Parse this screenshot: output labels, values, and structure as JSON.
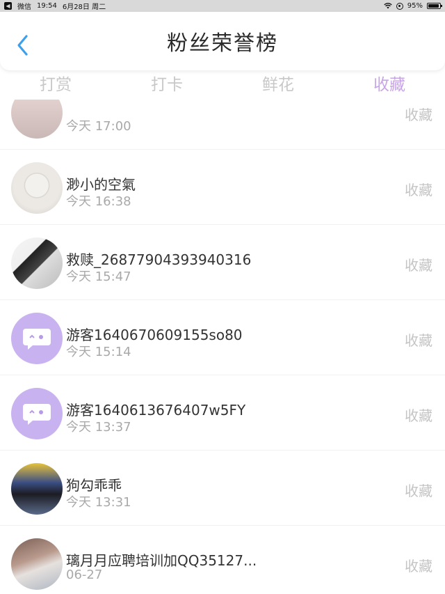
{
  "status_bar": {
    "app": "微信",
    "time": "19:54",
    "date": "6月28日 周二",
    "battery": "95%",
    "battery_level": 0.95
  },
  "header": {
    "title": "粉丝荣誉榜",
    "back_icon": "chevron-left-icon",
    "accent_color": "#3fa0ea"
  },
  "tabs": [
    {
      "label": "打赏",
      "active": false
    },
    {
      "label": "打卡",
      "active": false
    },
    {
      "label": "鲜花",
      "active": false
    },
    {
      "label": "收藏",
      "active": true
    }
  ],
  "tab_active_color": "#c8a6e6",
  "list": [
    {
      "name": "",
      "time": "今天 17:00",
      "action": "收藏"
    },
    {
      "name": "渺小的空氣",
      "time": "今天 16:38",
      "action": "收藏"
    },
    {
      "name": "救赎_26877904393940316",
      "time": "今天 15:47",
      "action": "收藏"
    },
    {
      "name": "游客1640670609155so80",
      "time": "今天 15:14",
      "action": "收藏"
    },
    {
      "name": "游客1640613676407w5FY",
      "time": "今天 13:37",
      "action": "收藏"
    },
    {
      "name": "狗勾乖乖",
      "time": "今天 13:31",
      "action": "收藏"
    },
    {
      "name": "璃月月应聘培训加QQ35127...",
      "time": "06-27",
      "action": "收藏"
    }
  ]
}
